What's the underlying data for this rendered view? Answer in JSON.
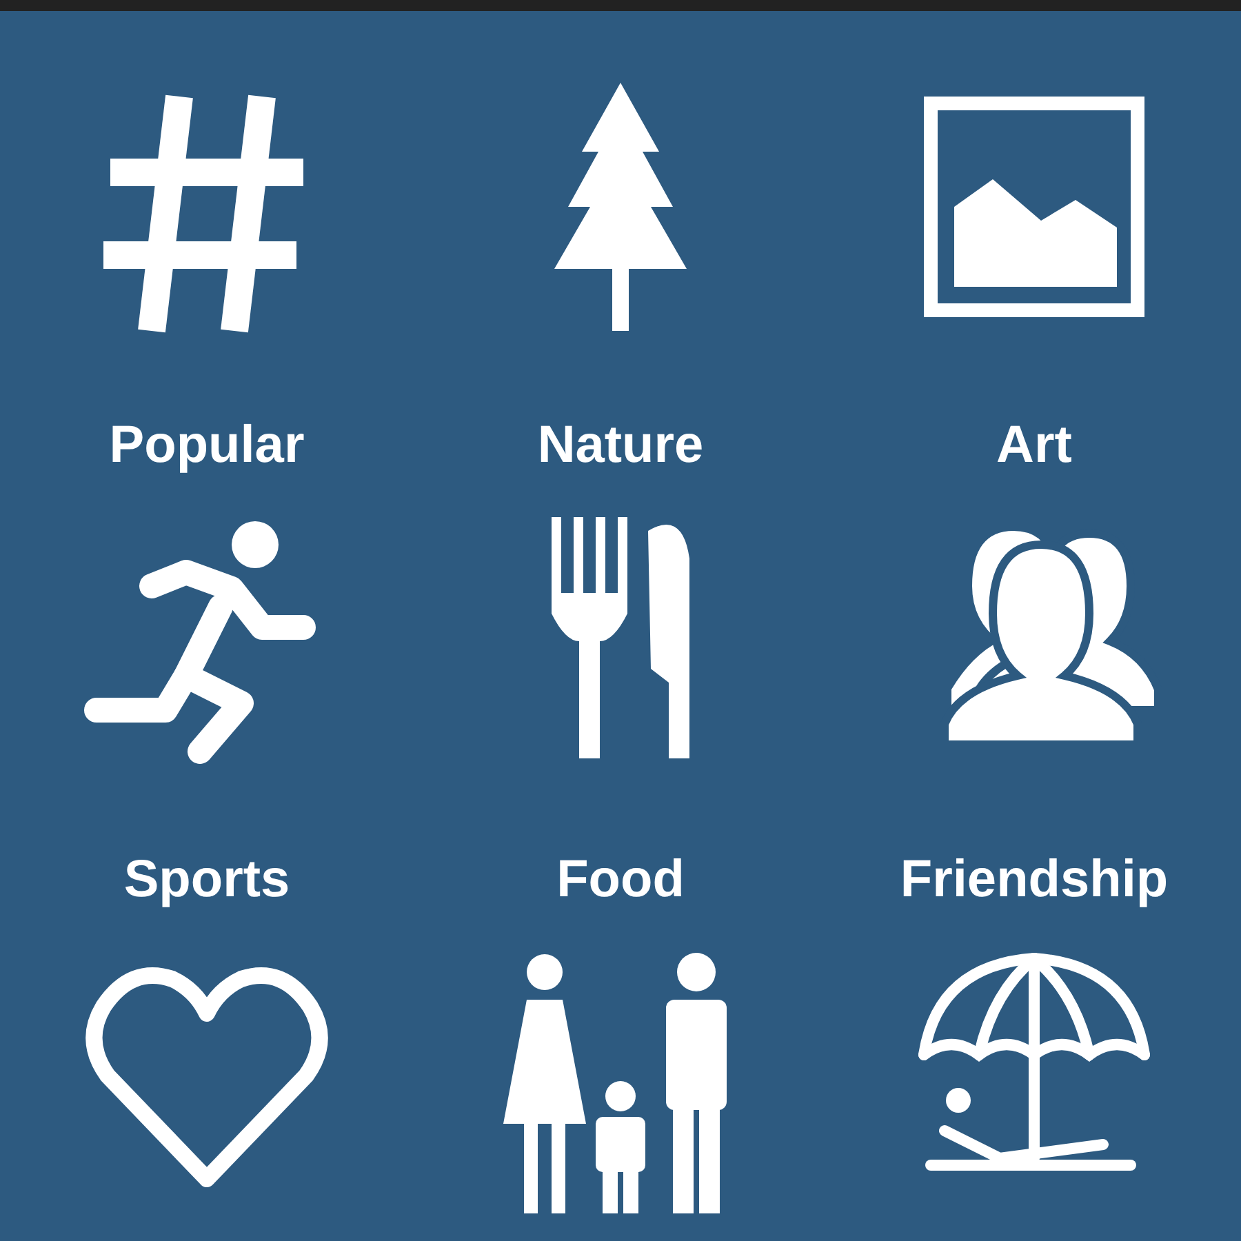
{
  "categories": [
    {
      "kind": "labeled",
      "label": "Popular"
    },
    {
      "kind": "labeled",
      "label": "Nature"
    },
    {
      "kind": "labeled",
      "label": "Art"
    },
    {
      "kind": "labeled",
      "label": "Sports"
    },
    {
      "kind": "labeled",
      "label": "Food"
    },
    {
      "kind": "labeled",
      "label": "Friendship"
    },
    {
      "kind": "icon_only"
    },
    {
      "kind": "icon_only"
    },
    {
      "kind": "icon_only"
    }
  ]
}
